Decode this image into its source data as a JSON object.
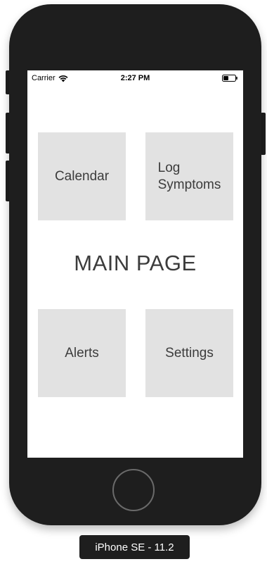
{
  "status_bar": {
    "carrier": "Carrier",
    "time": "2:27 PM"
  },
  "main": {
    "title": "MAIN PAGE",
    "tiles": {
      "calendar": "Calendar",
      "log_symptoms_line1": "Log",
      "log_symptoms_line2": "Symptoms",
      "alerts": "Alerts",
      "settings": "Settings"
    }
  },
  "simulator": {
    "device_label": "iPhone SE - 11.2"
  },
  "colors": {
    "device_body": "#1e1e1e",
    "tile_background": "#e2e2e2",
    "tile_text": "#3c3c3c",
    "screen_background": "#ffffff"
  },
  "icons": {
    "wifi": "wifi-icon",
    "battery": "battery-icon",
    "home": "home-button"
  }
}
